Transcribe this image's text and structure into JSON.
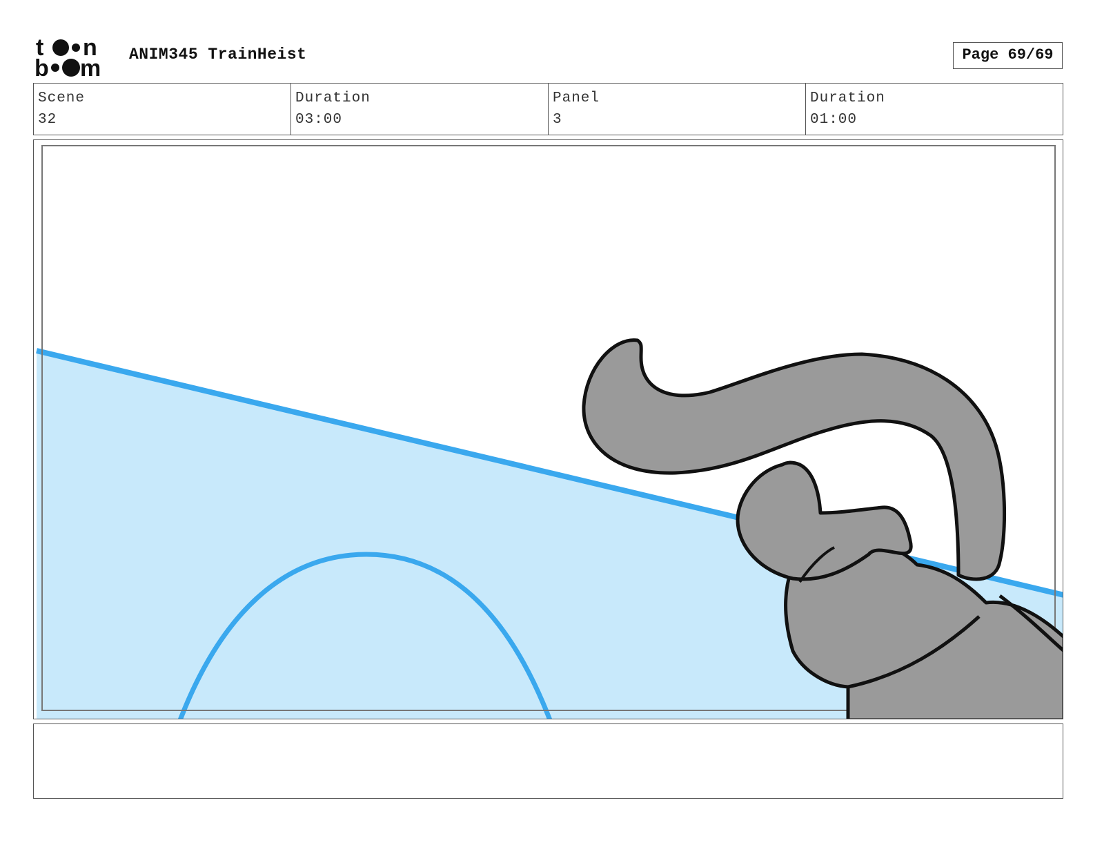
{
  "header": {
    "logo_text": "toon boom",
    "project_title": "ANIM345 TrainHeist",
    "page_label": "Page 69/69"
  },
  "info": {
    "scene_label": "Scene",
    "scene_value": "32",
    "scene_duration_label": "Duration",
    "scene_duration_value": "03:00",
    "panel_label": "Panel",
    "panel_value": "3",
    "panel_duration_label": "Duration",
    "panel_duration_value": "01:00"
  },
  "notes": {
    "text": ""
  },
  "colors": {
    "sky_fill": "#c8e9fb",
    "line_blue": "#3aa8ee",
    "creature_gray": "#9a9a9a",
    "outline": "#111111"
  }
}
